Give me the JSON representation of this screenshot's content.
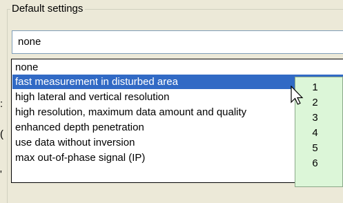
{
  "group": {
    "title": "Default settings"
  },
  "combo": {
    "value": "none"
  },
  "dropdown": {
    "items": [
      {
        "label": "none"
      },
      {
        "label": "fast measurement in disturbed area",
        "selected": true
      },
      {
        "label": "high lateral and vertical resolution"
      },
      {
        "label": "high resolution, maximum data amount and quality"
      },
      {
        "label": "enhanced depth penetration"
      },
      {
        "label": "use data without inversion"
      },
      {
        "label": "max out-of-phase signal (IP)"
      }
    ]
  },
  "number_panel": {
    "numbers": [
      "1",
      "2",
      "3",
      "4",
      "5",
      "6"
    ]
  },
  "partial_left": {
    "a": ":",
    "b": "(",
    "c": "'"
  },
  "colors": {
    "selection": "#316ac5",
    "number_panel": "#dcf6d8",
    "background": "#ece9d8"
  },
  "cursor": {
    "icon": "arrow-pointer-icon"
  }
}
